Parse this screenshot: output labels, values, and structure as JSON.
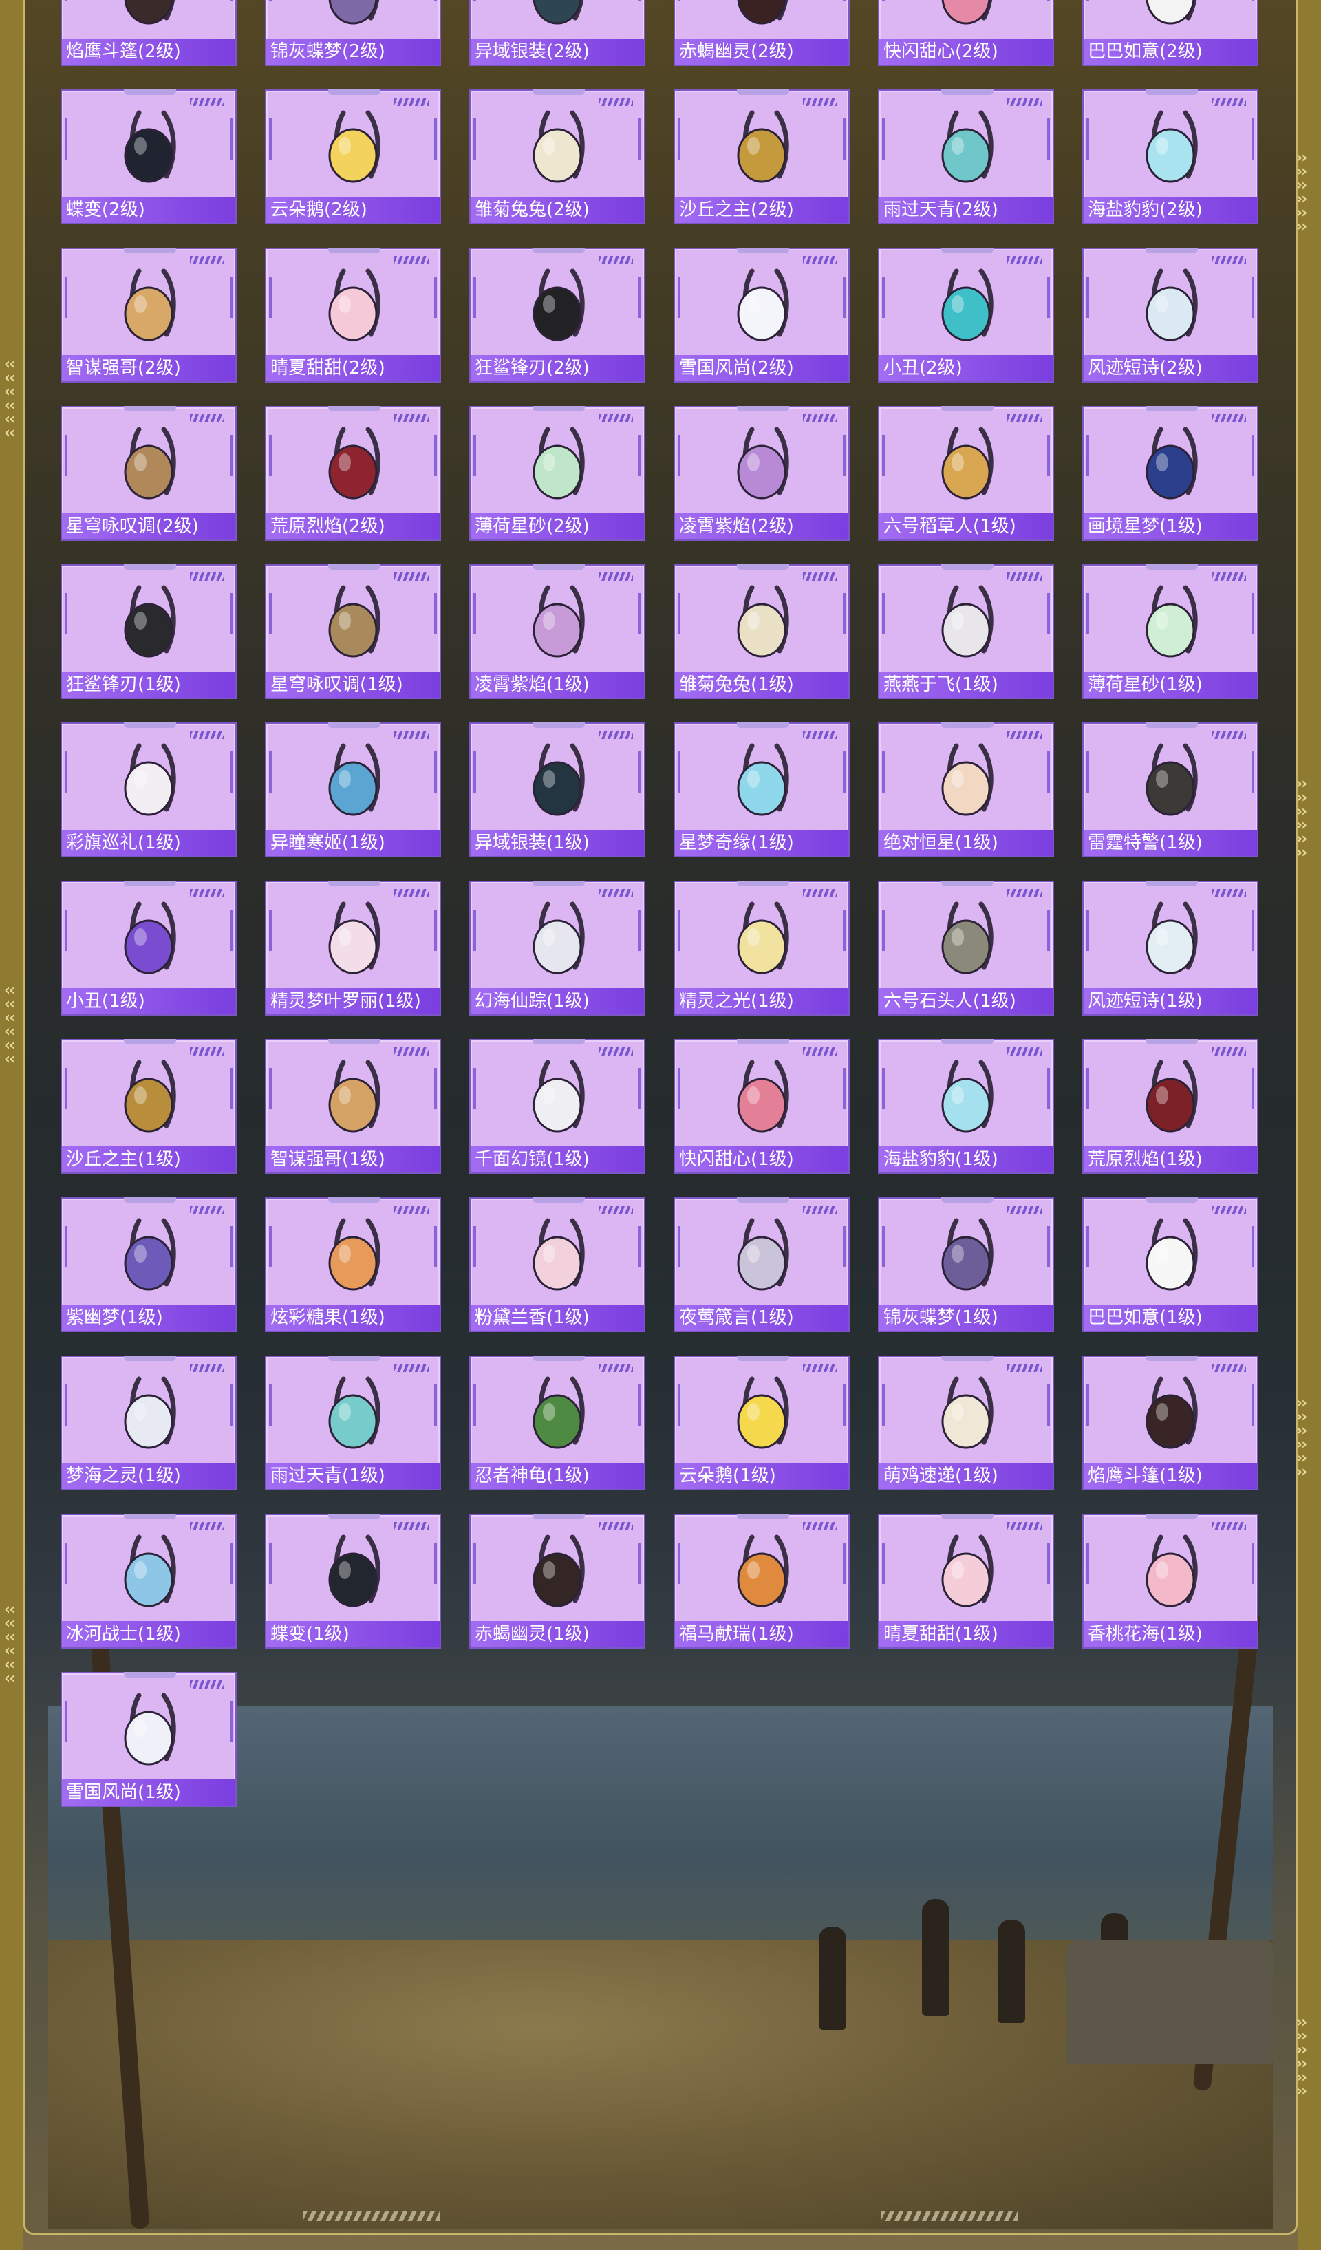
{
  "accent_colors": {
    "card_bg": "#dcb6f3",
    "label_bar": "#8a4fe6",
    "frame_gold": "#8f7a32"
  },
  "rows": [
    [
      {
        "name": "焰鹰斗篷(2级)",
        "icon": "backpack-icon",
        "color": "#3b2a2a"
      },
      {
        "name": "锦灰蝶梦(2级)",
        "icon": "backpack-icon",
        "color": "#7f6aa8"
      },
      {
        "name": "异域银装(2级)",
        "icon": "backpack-icon",
        "color": "#2e4652"
      },
      {
        "name": "赤蝎幽灵(2级)",
        "icon": "backpack-icon",
        "color": "#3a2222"
      },
      {
        "name": "快闪甜心(2级)",
        "icon": "backpack-icon",
        "color": "#e58aa6"
      },
      {
        "name": "巴巴如意(2级)",
        "icon": "backpack-icon",
        "color": "#f3f3f3"
      }
    ],
    [
      {
        "name": "蝶变(2级)",
        "icon": "backpack-icon",
        "color": "#1f2430"
      },
      {
        "name": "云朵鹅(2级)",
        "icon": "backpack-icon",
        "color": "#f3d35c"
      },
      {
        "name": "雏菊兔兔(2级)",
        "icon": "backpack-icon",
        "color": "#eee6cf"
      },
      {
        "name": "沙丘之主(2级)",
        "icon": "backpack-icon",
        "color": "#c49a3c"
      },
      {
        "name": "雨过天青(2级)",
        "icon": "backpack-icon",
        "color": "#6fc7c9"
      },
      {
        "name": "海盐豹豹(2级)",
        "icon": "backpack-icon",
        "color": "#a9e3f0"
      }
    ],
    [
      {
        "name": "智谋强哥(2级)",
        "icon": "backpack-icon",
        "color": "#d8a868"
      },
      {
        "name": "晴夏甜甜(2级)",
        "icon": "backpack-icon",
        "color": "#f6c9d8"
      },
      {
        "name": "狂鲨锋刃(2级)",
        "icon": "backpack-icon",
        "color": "#222225"
      },
      {
        "name": "雪国风尚(2级)",
        "icon": "backpack-icon",
        "color": "#f4f4fb"
      },
      {
        "name": "小丑(2级)",
        "icon": "backpack-icon",
        "color": "#3fbfc7"
      },
      {
        "name": "风迹短诗(2级)",
        "icon": "backpack-icon",
        "color": "#dbe9f3"
      }
    ],
    [
      {
        "name": "星穹咏叹调(2级)",
        "icon": "backpack-icon",
        "color": "#b0885a"
      },
      {
        "name": "荒原烈焰(2级)",
        "icon": "backpack-icon",
        "color": "#8d2430"
      },
      {
        "name": "薄荷星砂(2级)",
        "icon": "backpack-icon",
        "color": "#bfe6c8"
      },
      {
        "name": "凌霄紫焰(2级)",
        "icon": "backpack-icon",
        "color": "#b88ad6"
      },
      {
        "name": "六号稻草人(1级)",
        "icon": "backpack-icon",
        "color": "#d9a752"
      },
      {
        "name": "画境星梦(1级)",
        "icon": "backpack-icon",
        "color": "#2b3f8c"
      }
    ],
    [
      {
        "name": "狂鲨锋刃(1级)",
        "icon": "backpack-icon",
        "color": "#2a2a2e"
      },
      {
        "name": "星穹咏叹调(1级)",
        "icon": "backpack-icon",
        "color": "#a88a5c"
      },
      {
        "name": "凌霄紫焰(1级)",
        "icon": "backpack-icon",
        "color": "#c79ad8"
      },
      {
        "name": "雏菊兔兔(1级)",
        "icon": "backpack-icon",
        "color": "#e9e0c6"
      },
      {
        "name": "燕燕于飞(1级)",
        "icon": "backpack-icon",
        "color": "#e8e6ea"
      },
      {
        "name": "薄荷星砂(1级)",
        "icon": "backpack-icon",
        "color": "#cfeed3"
      }
    ],
    [
      {
        "name": "彩旗巡礼(1级)",
        "icon": "backpack-icon",
        "color": "#f3eef3"
      },
      {
        "name": "异瞳寒姬(1级)",
        "icon": "backpack-icon",
        "color": "#5aa5d2"
      },
      {
        "name": "异域银装(1级)",
        "icon": "backpack-icon",
        "color": "#233541"
      },
      {
        "name": "星梦奇缘(1级)",
        "icon": "backpack-icon",
        "color": "#8fd7ea"
      },
      {
        "name": "绝对恒星(1级)",
        "icon": "backpack-icon",
        "color": "#f2d8c3"
      },
      {
        "name": "雷霆特警(1级)",
        "icon": "backpack-icon",
        "color": "#3c3a36"
      }
    ],
    [
      {
        "name": "小丑(1级)",
        "icon": "backpack-icon",
        "color": "#7a4ccf"
      },
      {
        "name": "精灵梦叶罗丽(1级)",
        "icon": "backpack-icon",
        "color": "#f3dde8"
      },
      {
        "name": "幻海仙踪(1级)",
        "icon": "backpack-icon",
        "color": "#e6e6ef"
      },
      {
        "name": "精灵之光(1级)",
        "icon": "backpack-icon",
        "color": "#f2e2a0"
      },
      {
        "name": "六号石头人(1级)",
        "icon": "backpack-icon",
        "color": "#8b8a7a"
      },
      {
        "name": "风迹短诗(1级)",
        "icon": "backpack-icon",
        "color": "#e3eef4"
      }
    ],
    [
      {
        "name": "沙丘之主(1级)",
        "icon": "backpack-icon",
        "color": "#b88e3c"
      },
      {
        "name": "智谋强哥(1级)",
        "icon": "backpack-icon",
        "color": "#d4a264"
      },
      {
        "name": "千面幻镜(1级)",
        "icon": "backpack-icon",
        "color": "#efeef2"
      },
      {
        "name": "快闪甜心(1级)",
        "icon": "backpack-icon",
        "color": "#e47f98"
      },
      {
        "name": "海盐豹豹(1级)",
        "icon": "backpack-icon",
        "color": "#a5e0ee"
      },
      {
        "name": "荒原烈焰(1级)",
        "icon": "backpack-icon",
        "color": "#7d2129"
      }
    ],
    [
      {
        "name": "紫幽梦(1级)",
        "icon": "backpack-icon",
        "color": "#6c5bb8"
      },
      {
        "name": "炫彩糖果(1级)",
        "icon": "backpack-icon",
        "color": "#e79a5a"
      },
      {
        "name": "粉黛兰香(1级)",
        "icon": "backpack-icon",
        "color": "#f2d1dc"
      },
      {
        "name": "夜莺箴言(1级)",
        "icon": "backpack-icon",
        "color": "#c9c4d9"
      },
      {
        "name": "锦灰蝶梦(1级)",
        "icon": "backpack-icon",
        "color": "#6d5d99"
      },
      {
        "name": "巴巴如意(1级)",
        "icon": "backpack-icon",
        "color": "#f7f7f7"
      }
    ],
    [
      {
        "name": "梦海之灵(1级)",
        "icon": "backpack-icon",
        "color": "#e7e9f3"
      },
      {
        "name": "雨过天青(1级)",
        "icon": "backpack-icon",
        "color": "#77cccb"
      },
      {
        "name": "忍者神龟(1级)",
        "icon": "backpack-icon",
        "color": "#4f8a43"
      },
      {
        "name": "云朵鹅(1级)",
        "icon": "backpack-icon",
        "color": "#f5d84c"
      },
      {
        "name": "萌鸡速递(1级)",
        "icon": "backpack-icon",
        "color": "#f0e7d6"
      },
      {
        "name": "焰鹰斗篷(1级)",
        "icon": "backpack-icon",
        "color": "#3a2526"
      }
    ],
    [
      {
        "name": "冰河战士(1级)",
        "icon": "backpack-icon",
        "color": "#8ec6e8"
      },
      {
        "name": "蝶变(1级)",
        "icon": "backpack-icon",
        "color": "#22262e"
      },
      {
        "name": "赤蝎幽灵(1级)",
        "icon": "backpack-icon",
        "color": "#352626"
      },
      {
        "name": "福马献瑞(1级)",
        "icon": "backpack-icon",
        "color": "#e08a3e"
      },
      {
        "name": "晴夏甜甜(1级)",
        "icon": "backpack-icon",
        "color": "#f4cdd9"
      },
      {
        "name": "香桃花海(1级)",
        "icon": "backpack-icon",
        "color": "#f3b9c9"
      }
    ],
    [
      {
        "name": "雪国风尚(1级)",
        "icon": "backpack-icon",
        "color": "#f0f0f8"
      }
    ]
  ]
}
